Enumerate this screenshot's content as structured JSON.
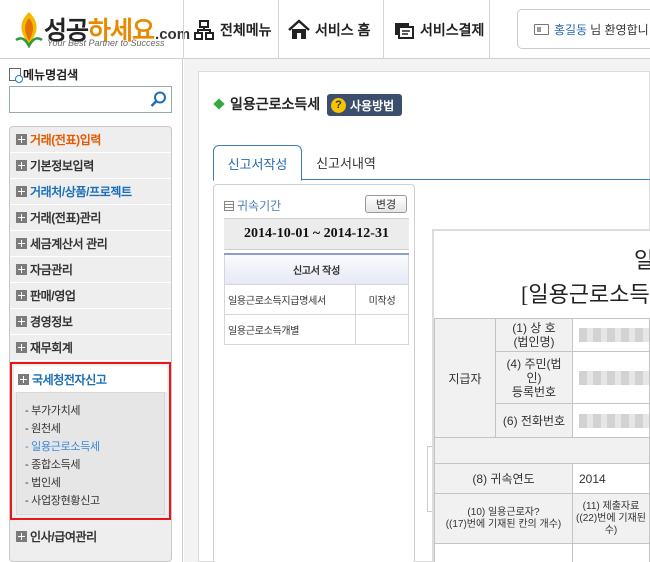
{
  "header": {
    "logo": {
      "main": "성공",
      "highlight": "하세요",
      "domain": ".com",
      "tagline": "Your Best Partner to Success"
    },
    "nav": [
      {
        "label": "전체메뉴",
        "icon": "sitemap-icon"
      },
      {
        "label": "서비스 홈",
        "icon": "home-icon"
      },
      {
        "label": "서비스결제",
        "icon": "payment-icon"
      }
    ],
    "user": {
      "name": "홍길동",
      "greeting": "님 환영합니"
    }
  },
  "sidebar": {
    "search_label": "메뉴명검색",
    "search_value": "",
    "search_placeholder": "",
    "menu": [
      {
        "label": "거래(전표)입력",
        "color": "#e55a00"
      },
      {
        "label": "기본정보입력",
        "color": "#333333"
      },
      {
        "label": "거래처/상품/프로젝트",
        "color": "#1a6fb8"
      },
      {
        "label": "거래(전표)관리",
        "color": "#333333"
      },
      {
        "label": "세금계산서 관리",
        "color": "#333333"
      },
      {
        "label": "자금관리",
        "color": "#333333"
      },
      {
        "label": "판매/영업",
        "color": "#333333"
      },
      {
        "label": "경영정보",
        "color": "#333333"
      },
      {
        "label": "재무회계",
        "color": "#333333"
      }
    ],
    "tax_menu": {
      "label": "국세청전자신고",
      "items": [
        {
          "label": "- 부가가치세",
          "active": false
        },
        {
          "label": "- 원천세",
          "active": false
        },
        {
          "label": "- 일용근로소득세",
          "active": true
        },
        {
          "label": "- 종합소득세",
          "active": false
        },
        {
          "label": "- 법인세",
          "active": false
        },
        {
          "label": "- 사업장현황신고",
          "active": false
        }
      ]
    },
    "bottom_menu": {
      "label": "인사/급여관리"
    }
  },
  "main": {
    "page_title": "일용근로소득세",
    "help_label": "사용방법",
    "tabs": [
      {
        "label": "신고서작성",
        "active": true
      },
      {
        "label": "신고서내역",
        "active": false
      }
    ],
    "period": {
      "label": "귀속기간",
      "change_label": "변경",
      "range": "2014-10-01 ~ 2014-12-31"
    },
    "report_table": {
      "header": "신고서 작성",
      "rows": [
        {
          "name": "일용근로소득지급명세서",
          "status": "미작성"
        },
        {
          "name": "일용근로소득개별",
          "status": ""
        }
      ]
    },
    "form": {
      "title_line1": "일",
      "title_line2": "[일용근로소득",
      "payer_label": "지급자",
      "fields": [
        {
          "label": "(1) 상 호\n(법인명)"
        },
        {
          "label": "(4) 주민(법\n인)\n등록번호"
        },
        {
          "label": "(6) 전화번호"
        }
      ],
      "year_label": "(8) 귀속연도",
      "year_value": "2014",
      "col10": "(10) 일용근로자?\n((17)번에 기재된 칸의 개수)",
      "col11": "(11) 제출자료\n((22)번에 기재된\n수)"
    }
  }
}
